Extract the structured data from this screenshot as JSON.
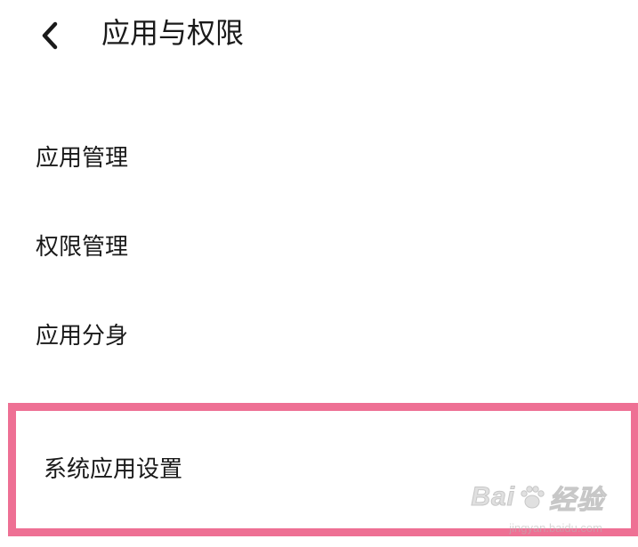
{
  "header": {
    "back_icon": "chevron-left-icon",
    "title": "应用与权限"
  },
  "menu": {
    "items": [
      {
        "label": "应用管理"
      },
      {
        "label": "权限管理"
      },
      {
        "label": "应用分身"
      },
      {
        "label": "系统应用设置",
        "highlighted": true
      }
    ]
  },
  "colors": {
    "highlight_border": "#ee7094",
    "background": "#ffffff",
    "text": "#1a1a1a"
  },
  "watermark": {
    "brand_prefix": "Bai",
    "brand_suffix": "经验",
    "paw_icon": "baidu-paw-icon",
    "url": "jingyan.baidu.com"
  }
}
